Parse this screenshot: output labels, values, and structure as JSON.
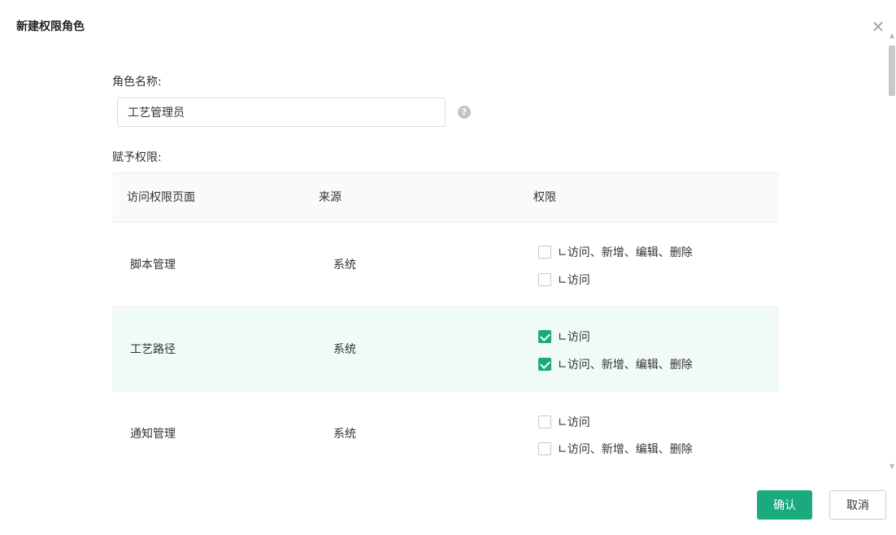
{
  "dialog": {
    "title": "新建权限角色",
    "close_glyph": "×"
  },
  "form": {
    "role_name_label": "角色名称:",
    "role_name_value": "工艺管理员",
    "help_glyph": "?",
    "permissions_label": "赋予权限:"
  },
  "table": {
    "headers": [
      "访问权限页面",
      "来源",
      "权限"
    ],
    "rows": [
      {
        "page": "脚本管理",
        "source": "系统",
        "selected": false,
        "options": [
          {
            "label": "∟访问、新增、编辑、删除",
            "checked": false
          },
          {
            "label": "∟访问",
            "checked": false
          }
        ]
      },
      {
        "page": "工艺路径",
        "source": "系统",
        "selected": true,
        "options": [
          {
            "label": "∟访问",
            "checked": true
          },
          {
            "label": "∟访问、新增、编辑、删除",
            "checked": true
          }
        ]
      },
      {
        "page": "通知管理",
        "source": "系统",
        "selected": false,
        "options": [
          {
            "label": "∟访问",
            "checked": false
          },
          {
            "label": "∟访问、新增、编辑、删除",
            "checked": false
          }
        ]
      }
    ]
  },
  "footer": {
    "confirm_label": "确认",
    "cancel_label": "取消"
  },
  "colors": {
    "accent": "#1aaa7e",
    "selected_row_bg": "#f0faf7"
  },
  "icons": {
    "close": "close-icon",
    "help": "help-icon",
    "checkbox_checked": "check-icon"
  }
}
